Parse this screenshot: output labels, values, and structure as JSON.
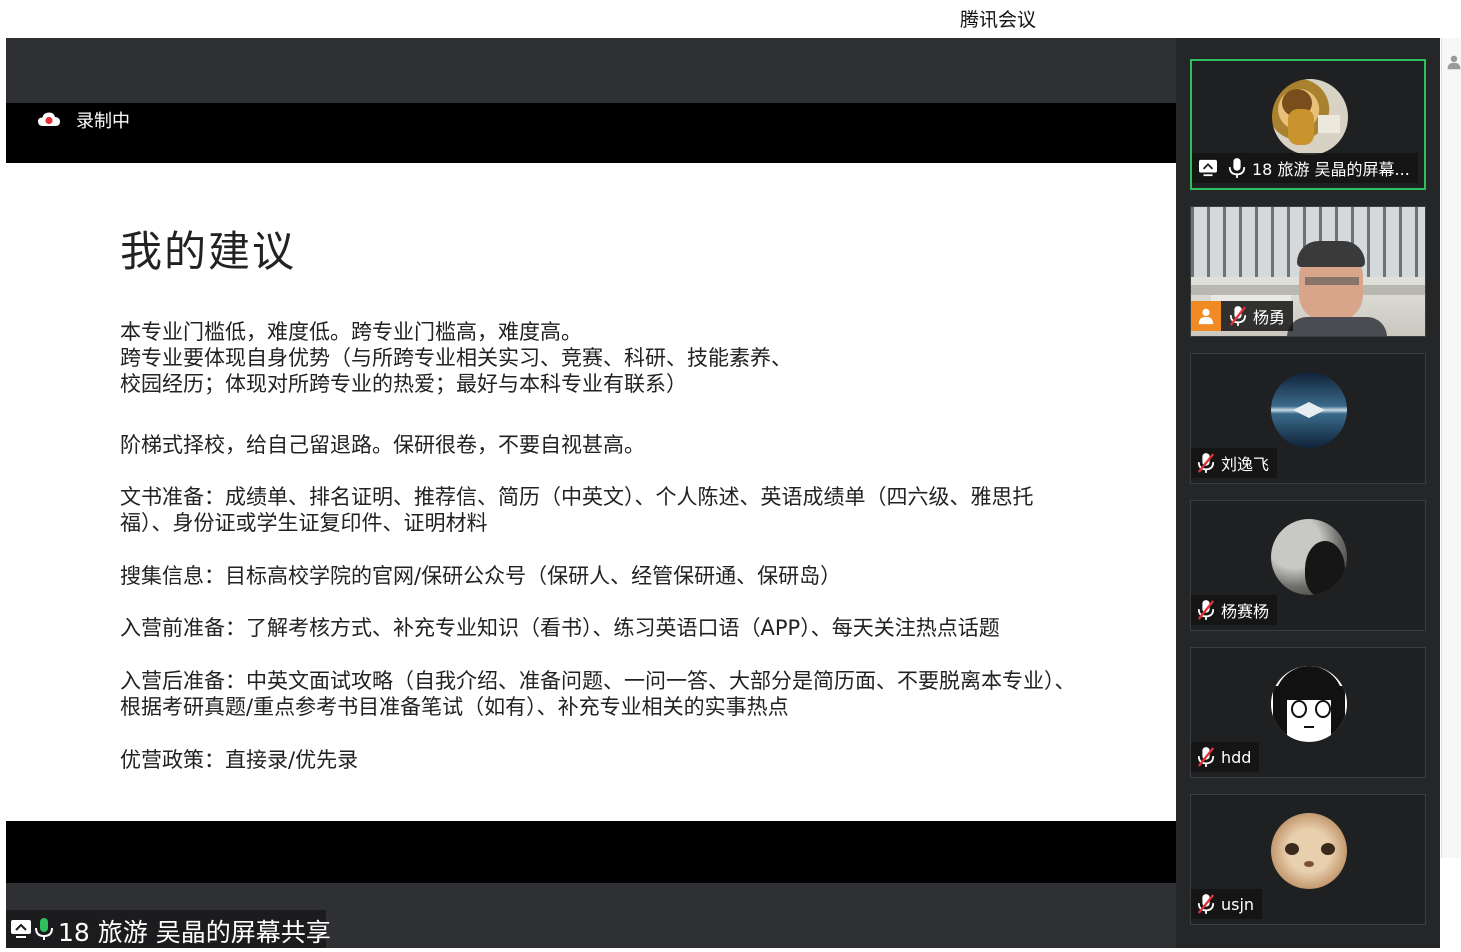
{
  "window": {
    "title": "腾讯会议"
  },
  "recording": {
    "label": "录制中",
    "icon": "cloud-record-icon",
    "color": "#e0303a"
  },
  "slide": {
    "title": "我的建议",
    "paragraphs": [
      [
        "本专业门槛低，难度低。跨专业门槛高，难度高。",
        "跨专业要体现自身优势（与所跨专业相关实习、竞赛、科研、技能素养、",
        "校园经历；体现对所跨专业的热爱；最好与本科专业有联系）"
      ],
      [
        "阶梯式择校，给自己留退路。保研很卷，不要自视甚高。"
      ],
      [
        "文书准备：成绩单、排名证明、推荐信、简历（中英文）、个人陈述、英语成绩单（四六级、雅思托",
        "福）、身份证或学生证复印件、证明材料"
      ],
      [
        "搜集信息：目标高校学院的官网/保研公众号（保研人、经管保研通、保研岛）"
      ],
      [
        "入营前准备：了解考核方式、补充专业知识（看书）、练习英语口语（APP）、每天关注热点话题"
      ],
      [
        "入营后准备：中英文面试攻略（自我介绍、准备问题、一问一答、大部分是简历面、不要脱离本专业）、",
        "根据考研真题/重点参考书目准备笔试（如有）、补充专业相关的实事热点"
      ],
      [
        "优营政策：直接录/优先录"
      ]
    ]
  },
  "share_caption": {
    "label": "18 旅游 吴晶的屏幕共享",
    "screen_icon": "screen-share-icon",
    "mic_icon": "mic-icon"
  },
  "participants": [
    {
      "name": "18 旅游 吴晶的屏幕...",
      "active": true,
      "mic": "on",
      "sharing": true,
      "avatar": "avatar-photo",
      "avatar_color": "#c9a45a"
    },
    {
      "name": "杨勇",
      "active": false,
      "mic": "muted",
      "video": true,
      "avatar": "video-feed",
      "avatar_color": "#d8d8d0"
    },
    {
      "name": "刘逸飞",
      "active": false,
      "mic": "muted",
      "avatar": "avatar-photo",
      "avatar_color": "#5a7fa0"
    },
    {
      "name": "杨赛杨",
      "active": false,
      "mic": "muted",
      "avatar": "avatar-photo",
      "avatar_color": "#7a7a78"
    },
    {
      "name": "hdd",
      "active": false,
      "mic": "muted",
      "avatar": "avatar-drawing",
      "avatar_color": "#ffffff"
    },
    {
      "name": "usjn",
      "active": false,
      "mic": "muted",
      "avatar": "avatar-photo",
      "avatar_color": "#d7b48f"
    }
  ],
  "colors": {
    "active_border": "#2fbf5c",
    "muted_icon": "#e0303a",
    "host_badge": "#f08a24"
  }
}
